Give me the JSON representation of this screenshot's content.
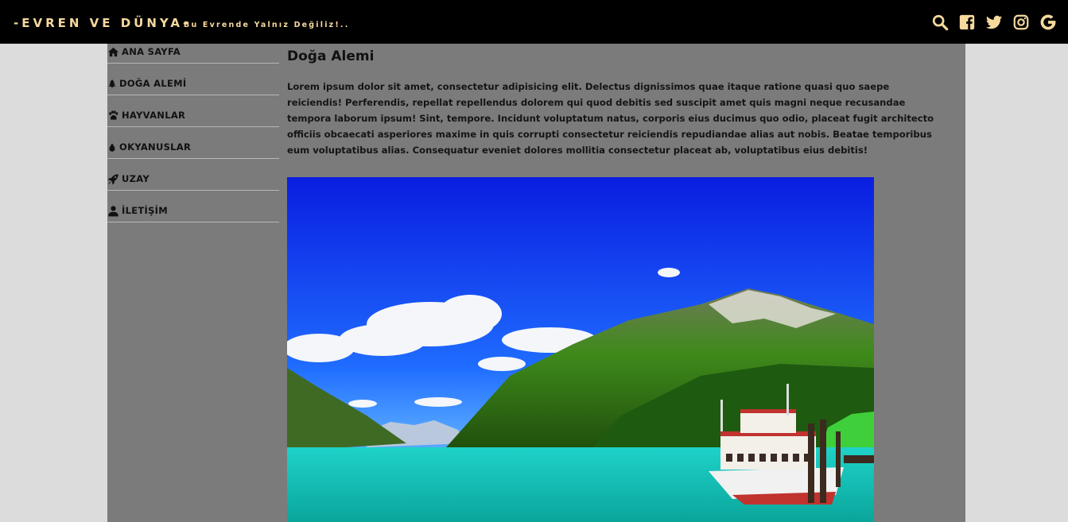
{
  "header": {
    "brand": "-EVREN VE DÜNYA-",
    "tagline": "Bu Evrende Yalnız Değiliz!..",
    "icons": [
      "search-icon",
      "facebook-icon",
      "twitter-icon",
      "instagram-icon",
      "google-icon"
    ]
  },
  "sidebar": {
    "items": [
      {
        "label": "ANA SAYFA",
        "icon": "home-icon"
      },
      {
        "label": "DOĞA ALEMİ",
        "icon": "tree-icon"
      },
      {
        "label": "HAYVANLAR",
        "icon": "paw-icon"
      },
      {
        "label": "OKYANUSLAR",
        "icon": "water-drop-icon"
      },
      {
        "label": "UZAY",
        "icon": "rocket-icon"
      },
      {
        "label": "İLETİŞİM",
        "icon": "user-icon"
      }
    ]
  },
  "main": {
    "title": "Doğa Alemi",
    "paragraph": "Lorem ipsum dolor sit amet, consectetur adipisicing elit. Delectus dignissimos quae itaque ratione quasi quo saepe reiciendis! Perferendis, repellat repellendus dolorem qui quod debitis sed suscipit amet quis magni neque recusandae tempora laborum ipsum! Sint, tempore. Incidunt voluptatum natus, corporis eius ducimus quo odio, placeat fugit architecto officiis obcaecati asperiores maxime in quis corrupti consectetur reiciendis repudiandae alias aut nobis. Beatae temporibus eum voluptatibus alias. Consequatur eveniet dolores mollitia consectetur placeat ab, voluptatibus eius debitis!",
    "image_subject": "mountain-lake-with-boat"
  },
  "colors": {
    "header_bg": "#000000",
    "accent": "#f6d99d",
    "page_bg": "#7b7b7b",
    "outer_bg": "#dcdcdc"
  }
}
